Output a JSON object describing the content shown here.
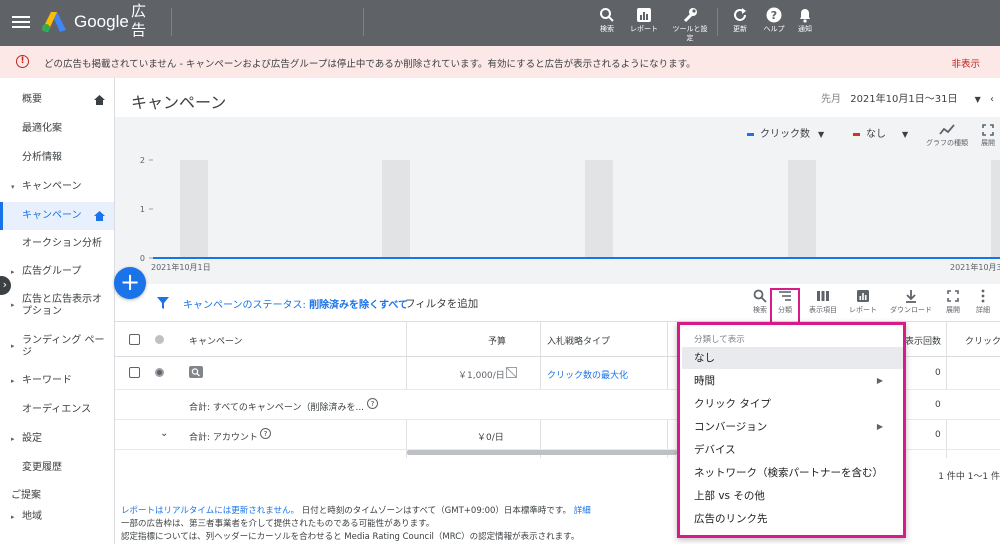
{
  "topbar": {
    "brand": "Google",
    "product": "広告",
    "buttons": [
      {
        "icon": "search-icon",
        "label": "検索"
      },
      {
        "icon": "report-icon",
        "label": "レポート"
      },
      {
        "icon": "wrench-icon",
        "label": "ツールと設定"
      },
      {
        "icon": "refresh-icon",
        "label": "更新"
      },
      {
        "icon": "help-icon",
        "label": "ヘルプ"
      },
      {
        "icon": "bell-icon",
        "label": "通知"
      }
    ]
  },
  "alert": {
    "icon_glyph": "!",
    "message": "どの広告も掲載されていません - キャンペーンおよび広告グループは停止中であるか削除されています。有効にすると広告が表示されるようになります。",
    "dismiss": "非表示"
  },
  "sidebar": {
    "items": [
      {
        "label": "概要",
        "home": true
      },
      {
        "label": "最適化案"
      },
      {
        "label": "分析情報"
      },
      {
        "label": "キャンペーン",
        "arrow": "▾"
      },
      {
        "label": "キャンペーン",
        "active": true,
        "home": true
      },
      {
        "label": "オークション分析"
      },
      {
        "label": "広告グループ",
        "arrow": "▸"
      },
      {
        "label": "広告と広告表示オプション",
        "arrow": "▸"
      },
      {
        "label": "ランディング ページ",
        "arrow": "▸"
      },
      {
        "label": "キーワード",
        "arrow": "▸"
      },
      {
        "label": "オーディエンス"
      },
      {
        "label": "設定",
        "arrow": "▸"
      },
      {
        "label": "変更履歴"
      },
      {
        "label": "ご提案"
      },
      {
        "label": "地域",
        "arrow": "▸"
      }
    ],
    "collapse_glyph": "›"
  },
  "page": {
    "title": "キャンペーン",
    "date_prefix": "先月",
    "date_range": "2021年10月1日〜31日"
  },
  "chart": {
    "metric1": "クリック数",
    "metric2": "なし",
    "metric1_color": "#1a73e8",
    "metric2_color": "#d93025",
    "graph_type_label": "グラフの種類",
    "expand_label": "展開",
    "y_ticks": [
      "2",
      "1",
      "0"
    ],
    "x_start": "2021年10月1日",
    "x_end": "2021年10月3"
  },
  "chart_data": {
    "type": "line",
    "x": [
      "2021年10月1日",
      "2021年10月31日"
    ],
    "series": [
      {
        "name": "クリック数",
        "values": [
          0,
          0
        ]
      }
    ],
    "ylim": [
      0,
      2
    ]
  },
  "filter": {
    "fab": "+",
    "status_label": "キャンペーンのステータス:",
    "status_value": "削除済みを除くすべて",
    "add_filter": "フィルタを追加"
  },
  "tools": [
    {
      "icon": "search-icon",
      "label": "検索"
    },
    {
      "icon": "segment-icon",
      "label": "分類"
    },
    {
      "icon": "columns-icon",
      "label": "表示項目"
    },
    {
      "icon": "report-icon",
      "label": "レポート"
    },
    {
      "icon": "download-icon",
      "label": "ダウンロード"
    },
    {
      "icon": "expand-icon",
      "label": "展開"
    },
    {
      "icon": "more-icon",
      "label": "詳細"
    }
  ],
  "table": {
    "headers": {
      "campaign": "キャンペーン",
      "budget": "予算",
      "bid": "入札戦略タイプ",
      "impr": "表示回数",
      "clicks": "クリック"
    },
    "rows": [
      {
        "budget": "￥1,000/日",
        "bid": "クリック数の最大化",
        "impr": "0"
      },
      {
        "label": "合計: すべてのキャンペーン（削除済みを...",
        "impr": "0"
      },
      {
        "label": "合計: アカウント",
        "budget": "￥0/日",
        "impr": "0"
      }
    ],
    "pager": "1 件中 1〜1 件"
  },
  "footer": {
    "line1_link": "レポートはリアルタイムには更新されません。",
    "line1_text": "日付と時刻のタイムゾーンはすべて（GMT+09:00）日本標準時です。",
    "line1_detail": "詳細",
    "line2": "一部の広告枠は、第三者事業者を介して提供されたものである可能性があります。",
    "line3": "認定指標については、列ヘッダーにカーソルを合わせると Media Rating Council（MRC）の認定情報が表示されます。"
  },
  "segment_menu": {
    "header": "分類して表示",
    "items": [
      {
        "label": "なし",
        "selected": true
      },
      {
        "label": "時間",
        "submenu": true
      },
      {
        "label": "クリック タイプ"
      },
      {
        "label": "コンバージョン",
        "submenu": true
      },
      {
        "label": "デバイス"
      },
      {
        "label": "ネットワーク（検索パートナーを含む）"
      },
      {
        "label": "上部 vs その他"
      },
      {
        "label": "広告のリンク先"
      }
    ]
  }
}
